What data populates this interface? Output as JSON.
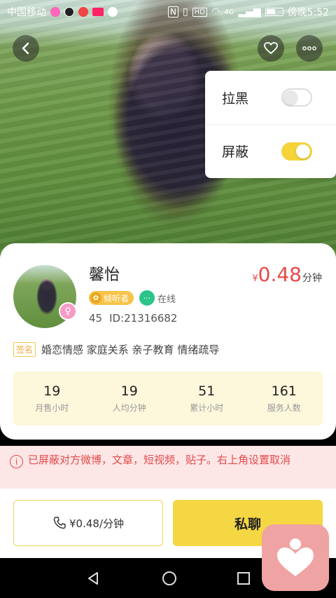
{
  "status_bar": {
    "carrier": "中国移动",
    "network": "4G",
    "time": "傍晚5:52"
  },
  "header": {
    "back_icon": "chevron-left-icon",
    "favorite_icon": "heart-outline-icon",
    "more_icon": "more-dots-icon"
  },
  "menu": {
    "items": [
      {
        "label": "拉黑",
        "toggle_on": false
      },
      {
        "label": "屏蔽",
        "toggle_on": true
      }
    ],
    "toggle_on_color": "#f5d43a"
  },
  "profile": {
    "name": "馨怡",
    "price_currency": "¥",
    "price_value": "0.48",
    "price_unit": "分钟",
    "role_tag": "倾听者",
    "status": "在线",
    "age": "45",
    "id": "ID:21316682",
    "signature_tag": "签名",
    "signature": "婚恋情感 家庭关系 亲子教育 情绪疏导"
  },
  "stats": [
    {
      "value": "19",
      "label": "月售小时"
    },
    {
      "value": "19",
      "label": "人均分钟"
    },
    {
      "value": "51",
      "label": "累计小时"
    },
    {
      "value": "161",
      "label": "服务人数"
    }
  ],
  "notice": {
    "text": "已屏蔽对方微博，文章，短视频，贴子。右上角设置取消",
    "color": "#e24b4b"
  },
  "actions": {
    "call_label": "¥0.48/分钟",
    "chat_label": "私聊"
  },
  "colors": {
    "accent_yellow": "#f5d643",
    "price_red": "#e84a4a"
  }
}
